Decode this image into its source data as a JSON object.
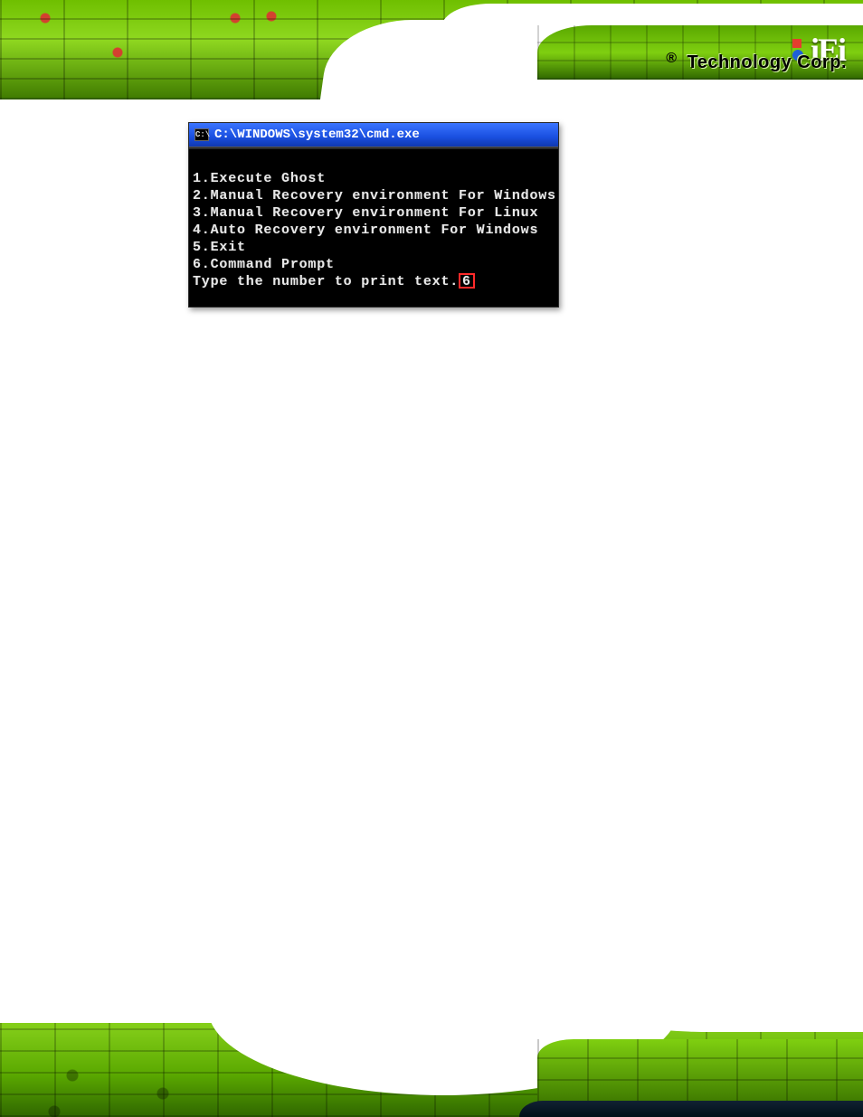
{
  "brand": {
    "logo_text": "iEi",
    "registered": "®",
    "company": "Technology Corp",
    "dot": "."
  },
  "cmd": {
    "icon_text": "C:\\",
    "title": "C:\\WINDOWS\\system32\\cmd.exe",
    "menu": [
      "1.Execute Ghost",
      "2.Manual Recovery environment For Windows",
      "3.Manual Recovery environment For Linux",
      "4.Auto Recovery environment For Windows",
      "5.Exit",
      "6.Command Prompt"
    ],
    "prompt": "Type the number to print text.",
    "input_value": "6"
  }
}
